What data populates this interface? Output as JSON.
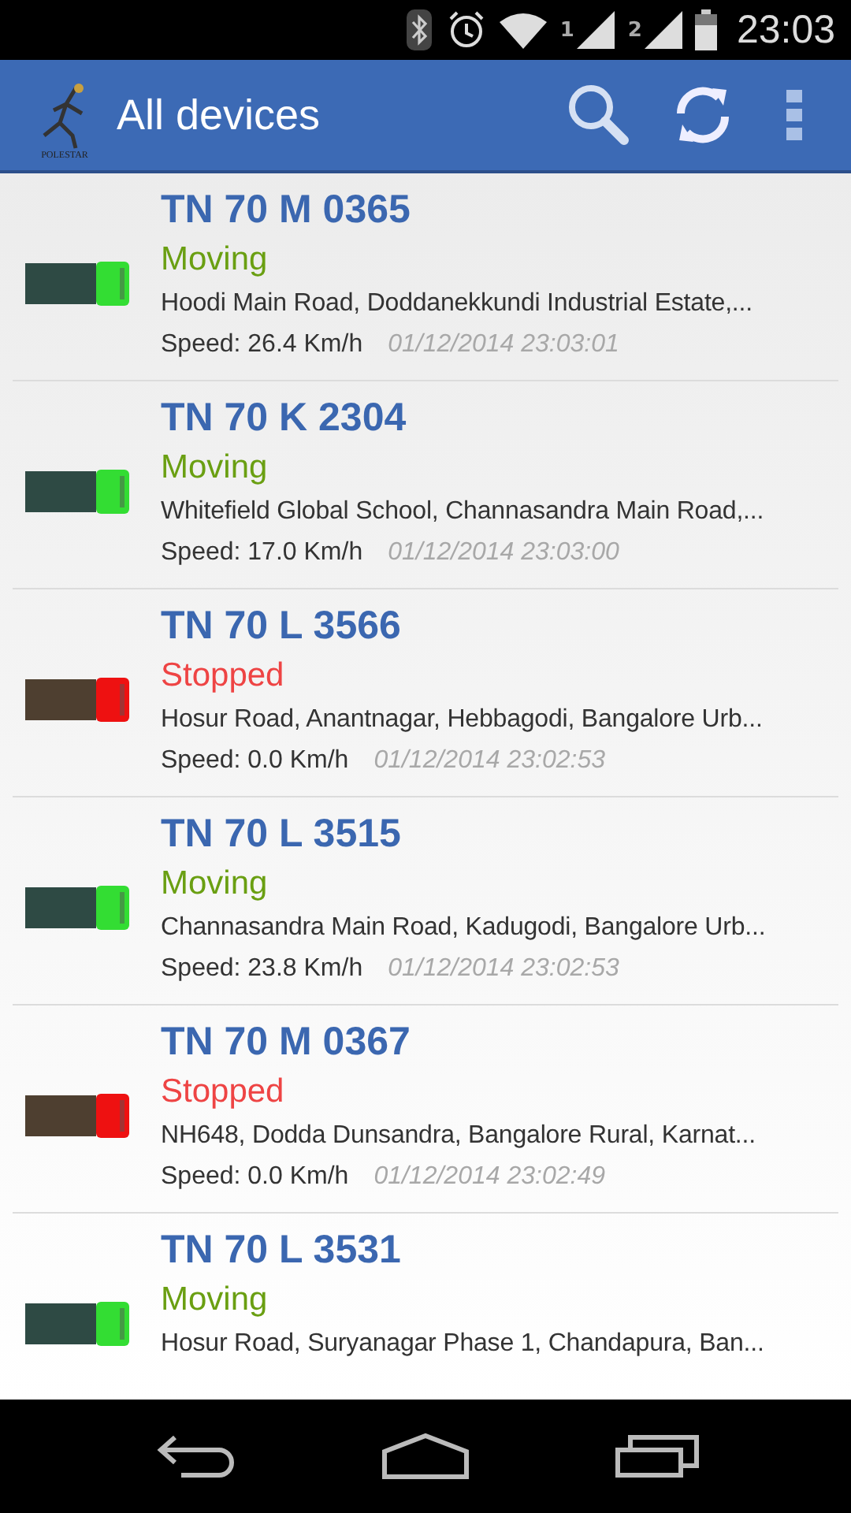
{
  "status_bar": {
    "sim_1": "1",
    "sim_2": "2",
    "time": "23:03"
  },
  "app_bar": {
    "logo_text": "POLESTAR",
    "title": "All devices"
  },
  "devices": [
    {
      "plate": "TN 70 M 0365",
      "kind": "moving",
      "status": "Moving",
      "address": "Hoodi Main Road, Doddanekkundi Industrial Estate,...",
      "speed": "Speed: 26.4 Km/h",
      "time": "01/12/2014 23:03:01"
    },
    {
      "plate": "TN 70 K 2304",
      "kind": "moving",
      "status": "Moving",
      "address": "Whitefield Global School, Channasandra Main Road,...",
      "speed": "Speed: 17.0 Km/h",
      "time": "01/12/2014 23:03:00"
    },
    {
      "plate": "TN 70 L 3566",
      "kind": "stopped",
      "status": "Stopped",
      "address": "Hosur Road, Anantnagar, Hebbagodi, Bangalore Urb...",
      "speed": "Speed: 0.0 Km/h",
      "time": "01/12/2014 23:02:53"
    },
    {
      "plate": "TN 70 L 3515",
      "kind": "moving",
      "status": "Moving",
      "address": "Channasandra Main Road, Kadugodi, Bangalore Urb...",
      "speed": "Speed: 23.8 Km/h",
      "time": "01/12/2014 23:02:53"
    },
    {
      "plate": "TN 70 M 0367",
      "kind": "stopped",
      "status": "Stopped",
      "address": "NH648, Dodda Dunsandra, Bangalore Rural, Karnat...",
      "speed": "Speed: 0.0 Km/h",
      "time": "01/12/2014 23:02:49"
    },
    {
      "plate": "TN 70 L 3531",
      "kind": "moving",
      "status": "Moving",
      "address": "Hosur Road, Suryanagar Phase 1, Chandapura, Ban..."
    }
  ]
}
